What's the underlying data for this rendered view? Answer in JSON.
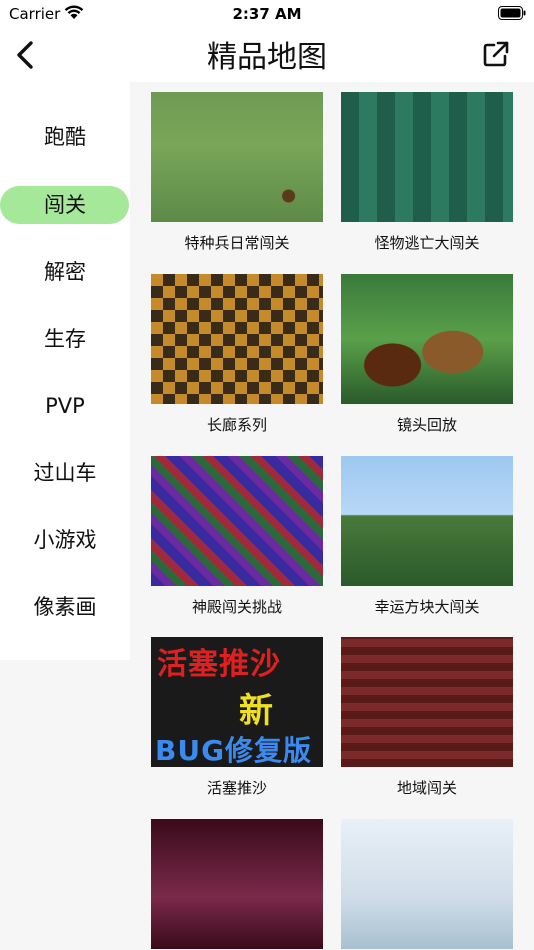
{
  "status_bar": {
    "carrier": "Carrier",
    "time": "2:37 AM"
  },
  "nav": {
    "title": "精品地图",
    "back_icon": "chevron-left-icon",
    "share_icon": "external-link-icon"
  },
  "sidebar": {
    "active_index": 1,
    "active_color": "#a6e89a",
    "items": [
      {
        "label": "跑酷"
      },
      {
        "label": "闯关"
      },
      {
        "label": "解密"
      },
      {
        "label": "生存"
      },
      {
        "label": "PVP"
      },
      {
        "label": "过山车"
      },
      {
        "label": "小游戏"
      },
      {
        "label": "像素画"
      }
    ]
  },
  "maps": [
    {
      "title": "特种兵日常闯关"
    },
    {
      "title": "怪物逃亡大闯关"
    },
    {
      "title": "长廊系列"
    },
    {
      "title": "镜头回放"
    },
    {
      "title": "神殿闯关挑战"
    },
    {
      "title": "幸运方块大闯关"
    },
    {
      "title": "活塞推沙",
      "thumb_text": [
        "活塞推沙",
        "新",
        "BUG修复版"
      ]
    },
    {
      "title": "地域闯关"
    },
    {
      "title": ""
    },
    {
      "title": ""
    }
  ]
}
